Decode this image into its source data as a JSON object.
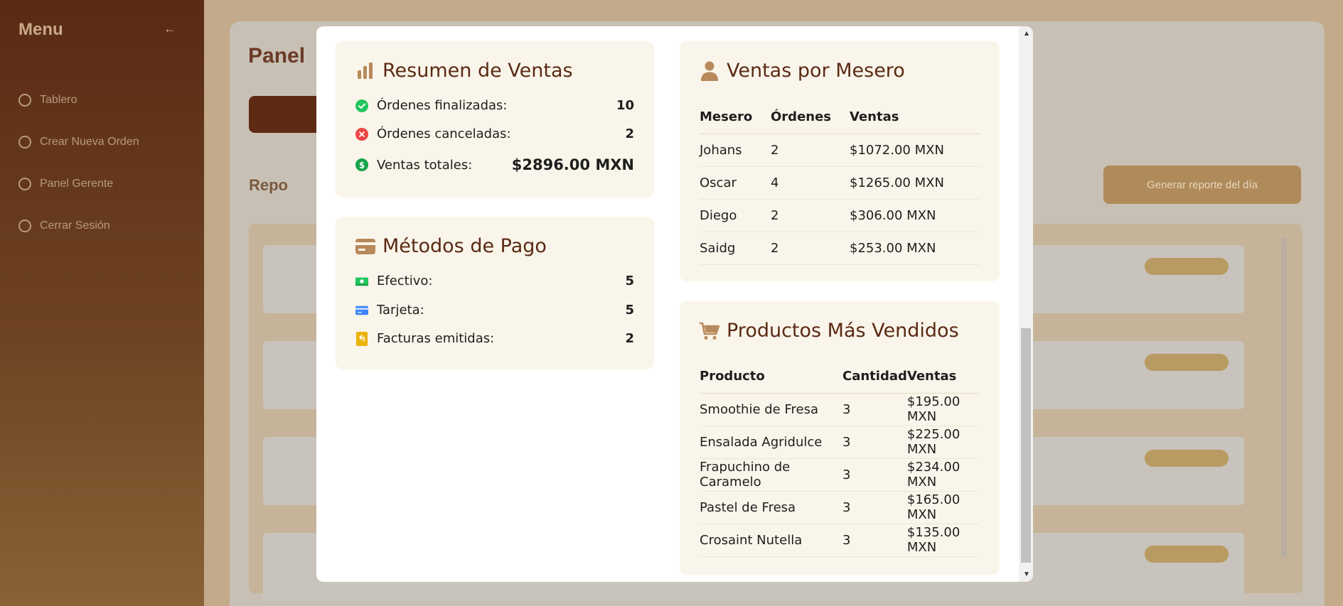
{
  "background": {
    "sidebar_title": "Menu",
    "sidebar_items": [
      "Tablero",
      "Crear Nueva Orden",
      "Panel Gerente",
      "Cerrar Sesión"
    ],
    "page_title": "Panel",
    "section_title": "Repo",
    "generate_button": "Generar reporte del día"
  },
  "resumen": {
    "title": "Resumen de Ventas",
    "finalizadas_label": "Órdenes finalizadas:",
    "finalizadas_value": "10",
    "canceladas_label": "Órdenes canceladas:",
    "canceladas_value": "2",
    "totales_label": "Ventas totales:",
    "totales_value": "$2896.00 MXN"
  },
  "pagos": {
    "title": "Métodos de Pago",
    "efectivo_label": "Efectivo:",
    "efectivo_value": "5",
    "tarjeta_label": "Tarjeta:",
    "tarjeta_value": "5",
    "facturas_label": "Facturas emitidas:",
    "facturas_value": "2"
  },
  "meseros": {
    "title": "Ventas por Mesero",
    "headers": [
      "Mesero",
      "Órdenes",
      "Ventas"
    ],
    "rows": [
      [
        "Johans",
        "2",
        "$1072.00 MXN"
      ],
      [
        "Oscar",
        "4",
        "$1265.00 MXN"
      ],
      [
        "Diego",
        "2",
        "$306.00 MXN"
      ],
      [
        "Saidg",
        "2",
        "$253.00 MXN"
      ]
    ]
  },
  "productos": {
    "title": "Productos Más Vendidos",
    "headers": [
      "Producto",
      "Cantidad",
      "Ventas"
    ],
    "rows": [
      [
        "Smoothie de Fresa",
        "3",
        "$195.00 MXN"
      ],
      [
        "Ensalada Agridulce",
        "3",
        "$225.00 MXN"
      ],
      [
        "Frapuchino de Caramelo",
        "3",
        "$234.00 MXN"
      ],
      [
        "Pastel de Fresa",
        "3",
        "$165.00 MXN"
      ],
      [
        "Crosaint Nutella",
        "3",
        "$135.00 MXN"
      ]
    ]
  },
  "colors": {
    "accent": "#5a2a14",
    "icon": "#b8895a",
    "card_bg": "#faf5ea",
    "success": "#22c55e",
    "danger": "#ef4444",
    "money": "#16a34a",
    "card_blue": "#3b82f6",
    "invoice": "#eab308"
  }
}
